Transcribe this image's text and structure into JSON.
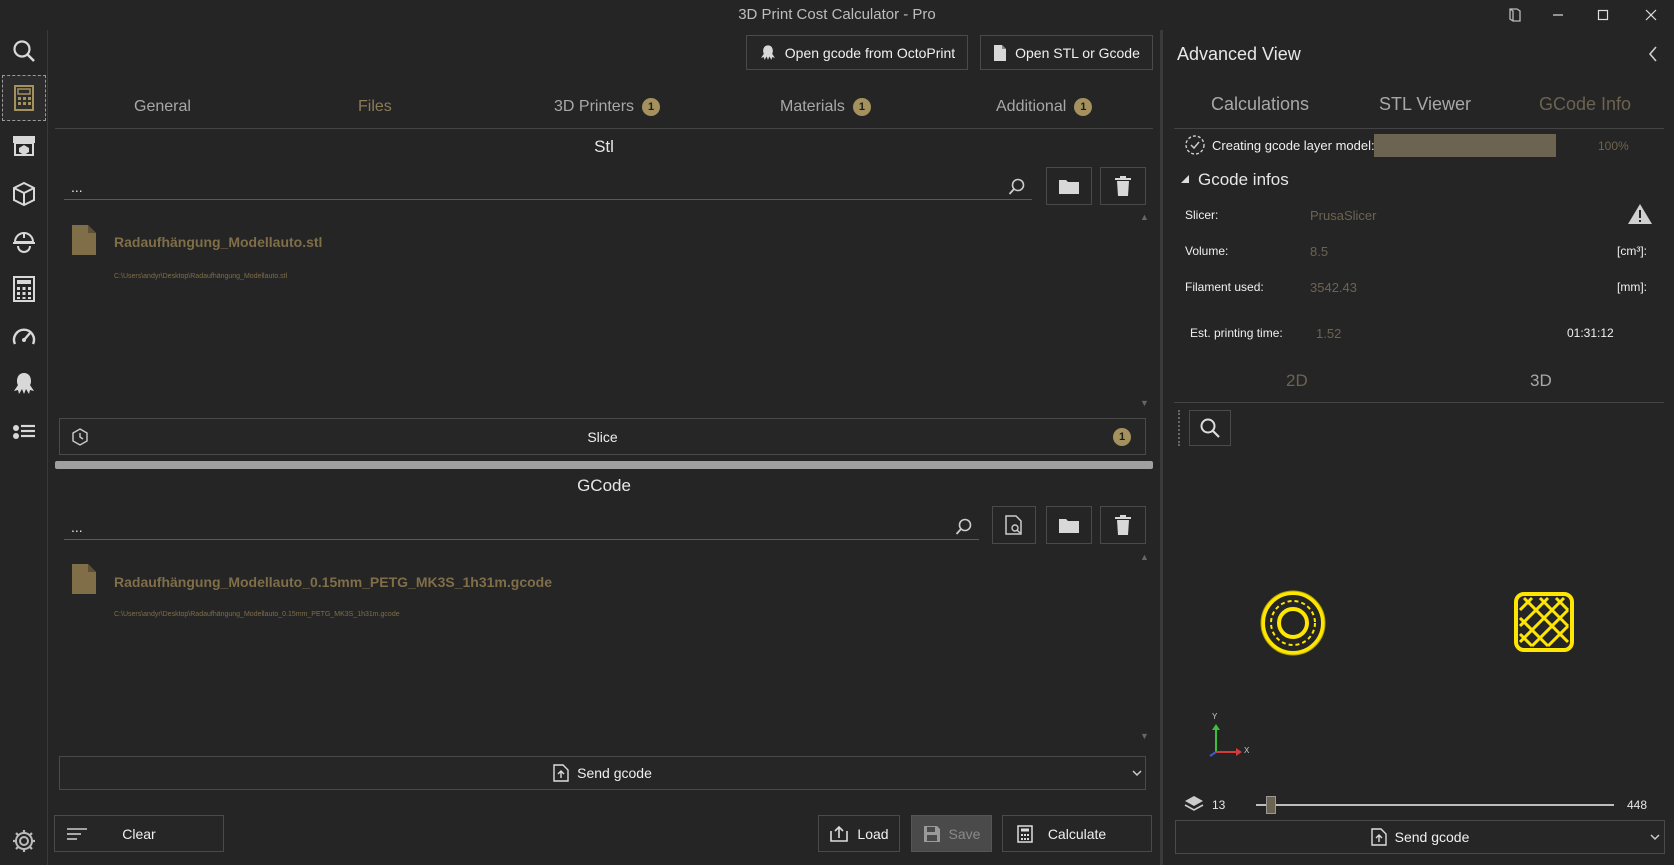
{
  "window": {
    "title": "3D Print Cost Calculator - Pro"
  },
  "toolbar": {
    "octoprint_label": "Open gcode from OctoPrint",
    "open_label": "Open STL or Gcode"
  },
  "tabs": [
    {
      "label": "General"
    },
    {
      "label": "Files"
    },
    {
      "label": "3D Printers",
      "badge": "1"
    },
    {
      "label": "Materials",
      "badge": "1"
    },
    {
      "label": "Additional",
      "badge": "1"
    }
  ],
  "stl": {
    "title": "Stl",
    "search_value": "...",
    "file_name": "Radaufhängung_Modellauto.stl",
    "file_path": "C:\\Users\\andyr\\Desktop\\Radaufhängung_Modellauto.stl",
    "slice_label": "Slice",
    "slice_badge": "1"
  },
  "gcode": {
    "title": "GCode",
    "search_value": "...",
    "file_name": "Radaufhängung_Modellauto_0.15mm_PETG_MK3S_1h31m.gcode",
    "file_path": "C:\\Users\\andyr\\Desktop\\Radaufhängung_Modellauto_0.15mm_PETG_MK3S_1h31m.gcode",
    "send_label": "Send gcode"
  },
  "footer": {
    "clear_label": "Clear",
    "load_label": "Load",
    "save_label": "Save",
    "calculate_label": "Calculate"
  },
  "advanced": {
    "title": "Advanced View",
    "tabs": [
      "Calculations",
      "STL Viewer",
      "GCode Info"
    ],
    "progress_label": "Creating gcode layer model:",
    "progress_value": 1.0,
    "progress_text": "100%",
    "section_title": "Gcode infos",
    "slicer_label": "Slicer:",
    "slicer_value": "PrusaSlicer",
    "volume_label": "Volume:",
    "volume_value": "8.5",
    "volume_unit": "[cm³]:",
    "filament_label": "Filament used:",
    "filament_value": "3542.43",
    "filament_unit": "[mm]:",
    "time_label": "Est. printing time:",
    "time_value": "1.52",
    "time_hms": "01:31:12",
    "view_tabs": [
      "2D",
      "3D"
    ],
    "axis_y": "Y",
    "axis_x": "X",
    "layer_current": "13",
    "layer_max": "448",
    "layer_fraction": 0.029,
    "send_label": "Send gcode"
  },
  "colors": {
    "accent": "#a4915d",
    "gold_text": "#7f6e48",
    "print_yellow": "#ffe600"
  }
}
